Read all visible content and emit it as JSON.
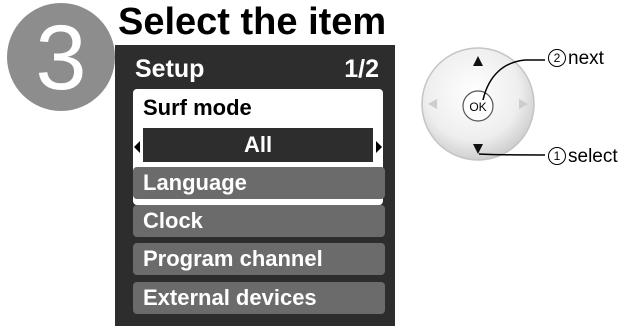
{
  "step": {
    "number": "3",
    "title": "Select the item"
  },
  "menu": {
    "title": "Setup",
    "page": "1/2",
    "selected": {
      "label": "Surf mode",
      "value": "All"
    },
    "items": [
      {
        "label": "Language"
      },
      {
        "label": "Clock"
      },
      {
        "label": "Program channel"
      },
      {
        "label": "External devices"
      }
    ]
  },
  "remote": {
    "ok_label": "OK",
    "next": {
      "number": "2",
      "text": "next"
    },
    "select": {
      "number": "1",
      "text": "select"
    }
  },
  "colors": {
    "step_circle": "#8d8d8d",
    "menu_background": "#2d2d2d",
    "menu_item": "#6b6b6b",
    "selected_box": "#ffffff"
  }
}
